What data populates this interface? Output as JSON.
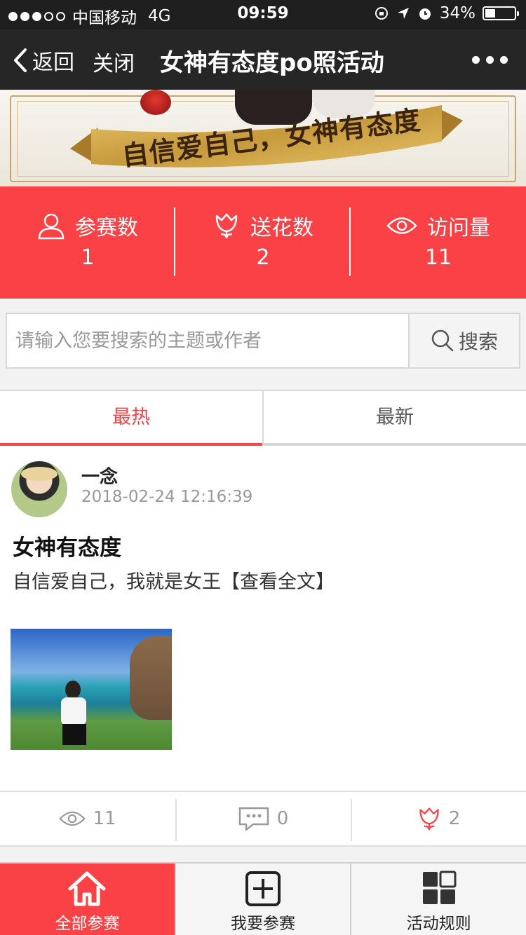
{
  "status_bar": {
    "carrier": "中国移动",
    "network": "4G",
    "time": "09:59",
    "battery": "34%",
    "battery_level": 0.34
  },
  "nav": {
    "back_label": "返回",
    "close_label": "关闭",
    "title": "女神有态度po照活动"
  },
  "banner": {
    "slogan": "自信爱自己，女神有态度"
  },
  "stats": [
    {
      "icon": "person-icon",
      "label": "参赛数",
      "value": "1"
    },
    {
      "icon": "flower-icon",
      "label": "送花数",
      "value": "2"
    },
    {
      "icon": "eye-icon",
      "label": "访问量",
      "value": "11"
    }
  ],
  "search": {
    "placeholder": "请输入您要搜索的主题或作者",
    "value": "",
    "button_label": "搜索"
  },
  "tabs": [
    {
      "label": "最热",
      "active": true
    },
    {
      "label": "最新",
      "active": false
    }
  ],
  "post": {
    "author": "一念",
    "date": "2018-02-24 12:16:39",
    "title": "女神有态度",
    "body": "自信爱自己，我就是女王【查看全文】",
    "views": "11",
    "comments": "0",
    "flowers": "2"
  },
  "bottom_nav": [
    {
      "label": "全部参赛",
      "icon": "home-icon",
      "active": true
    },
    {
      "label": "我要参赛",
      "icon": "plus-box-icon",
      "active": false
    },
    {
      "label": "活动规则",
      "icon": "grid-icon",
      "active": false
    }
  ],
  "colors": {
    "accent": "#fa4145",
    "nav_bg": "#262626",
    "gold": "#c9a56a"
  }
}
